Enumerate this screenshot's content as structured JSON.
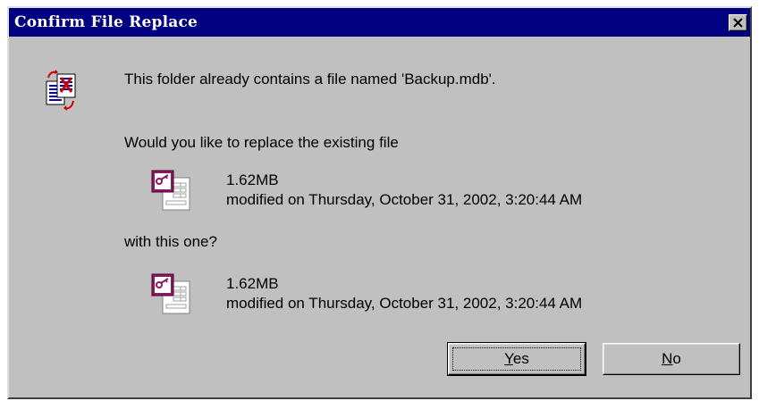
{
  "dialog": {
    "title": "Confirm File Replace",
    "close_symbol": "×"
  },
  "message": {
    "folder_notice": "This folder already contains a file named 'Backup.mdb'.",
    "question": "Would you like to replace the existing file",
    "with_this": "with this one?"
  },
  "existing_file": {
    "size": "1.62MB",
    "modified": "modified on Thursday, October 31, 2002, 3:20:44 AM",
    "icon": "access-database-icon"
  },
  "new_file": {
    "size": "1.62MB",
    "modified": "modified on Thursday, October 31, 2002, 3:20:44 AM",
    "icon": "access-database-icon"
  },
  "buttons": {
    "yes": {
      "mnemonic": "Y",
      "rest": "es"
    },
    "no": {
      "mnemonic": "N",
      "rest": "o"
    }
  },
  "icons": {
    "header": "file-replace-icon",
    "close": "close-icon"
  },
  "colors": {
    "titlebar": "#000080",
    "face": "#c0c0c0",
    "access_icon": "#8b1a5c"
  }
}
